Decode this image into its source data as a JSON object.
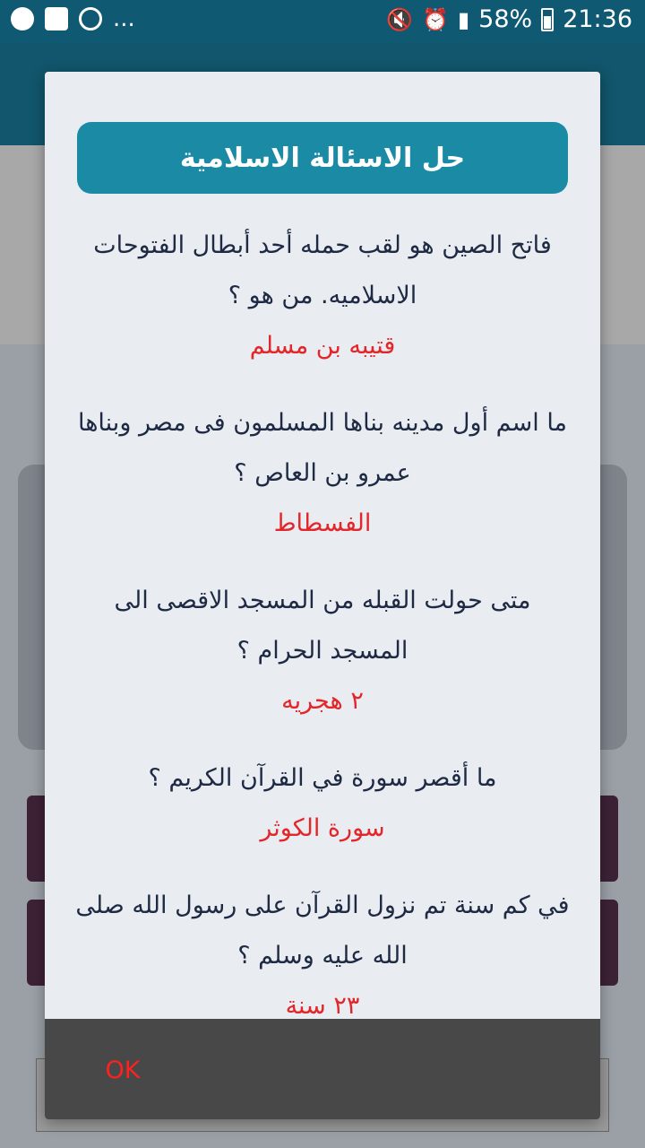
{
  "status_bar": {
    "left_icons": [
      "messenger-icon",
      "facebook-icon",
      "planet-icon"
    ],
    "more": "...",
    "battery": "58%",
    "time": "21:36"
  },
  "dialog": {
    "title": "حل الاسئالة الاسلامية",
    "items": [
      {
        "question": "فاتح الصين هو لقب حمله أحد أبطال الفتوحات الاسلاميه. من هو ؟",
        "answer": "قتيبه بن مسلم"
      },
      {
        "question": "ما اسم أول مدينه بناها المسلمون فى مصر وبناها عمرو بن العاص ؟",
        "answer": "الفسطاط"
      },
      {
        "question": "متى حولت القبله من المسجد الاقصى الى المسجد الحرام ؟",
        "answer": "٢ هجريه"
      },
      {
        "question": "ما أقصر سورة في القرآن الكريم ؟",
        "answer": "سورة الكوثر"
      },
      {
        "question": "في كم سنة تم نزول القرآن على رسول الله صلى الله عليه وسلم ؟",
        "answer": "٢٣ سنة"
      }
    ],
    "ok_label": "OK"
  },
  "colors": {
    "status_bar": "#0f5a72",
    "title_bg": "#1b8aa5",
    "question_text": "#1e2a44",
    "answer_text": "#e2262a",
    "ok_text": "#ff2020",
    "footer_bg": "#484848"
  }
}
